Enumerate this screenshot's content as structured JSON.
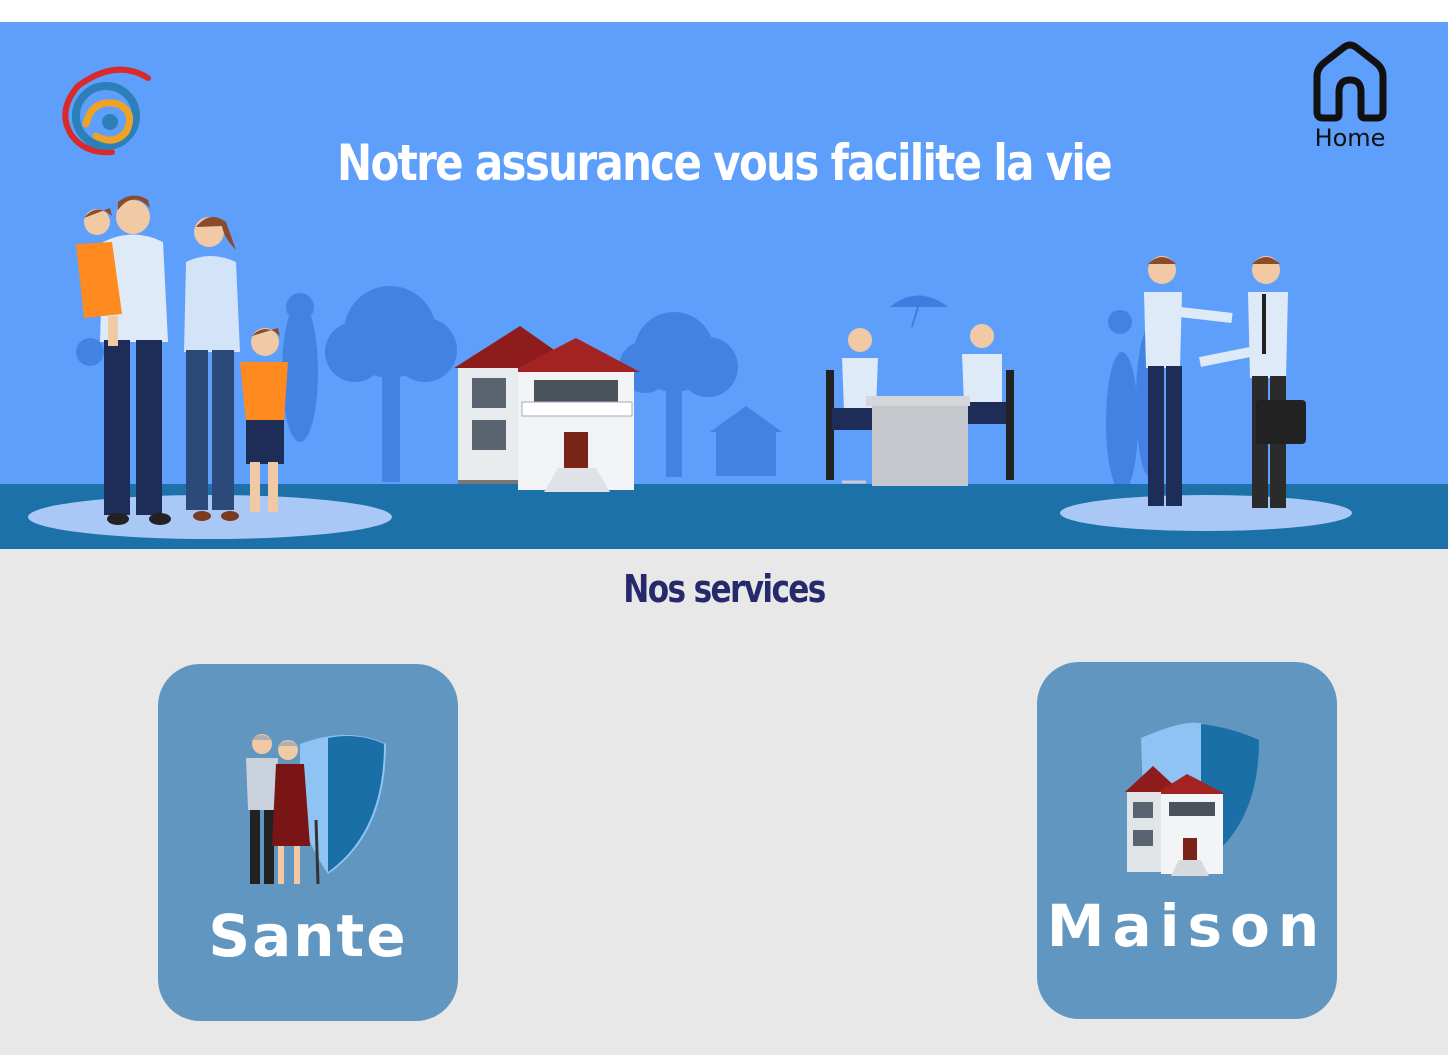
{
  "header": {
    "title": "Notre assurance vous facilite la vie",
    "home_label": "Home",
    "logo_icon": "swirl-logo-icon",
    "home_icon": "home-outline-icon"
  },
  "services": {
    "title": "Nos services",
    "items": [
      {
        "label": "Sante",
        "icon": "elderly-couple-shield-icon"
      },
      {
        "label": "Maison",
        "icon": "house-shield-icon"
      }
    ]
  },
  "colors": {
    "hero_background": "#5e9ffb",
    "ground": "#1c72a8",
    "section_background": "#e8e8e8",
    "section_title": "#262a6d",
    "card_background": "#6096c0",
    "text_light": "#ffffff"
  }
}
